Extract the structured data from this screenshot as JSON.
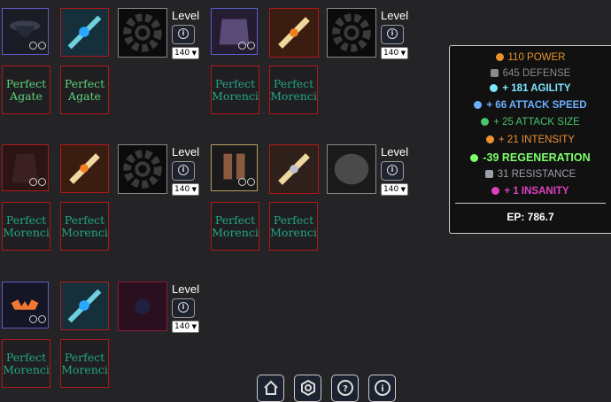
{
  "level_label": "Level",
  "level_value": "140",
  "gems": {
    "row1": [
      {
        "line1": "Perfect",
        "line2": "Agate",
        "color": "#5fd37a"
      },
      {
        "line1": "Perfect",
        "line2": "Agate",
        "color": "#5fd37a"
      },
      {
        "line1": "Perfect",
        "line2": "Morenci",
        "color": "#25a386"
      },
      {
        "line1": "Perfect",
        "line2": "Morenci",
        "color": "#25a386"
      }
    ],
    "row2": [
      {
        "line1": "Perfect",
        "line2": "Morenci",
        "color": "#25a386"
      },
      {
        "line1": "Perfect",
        "line2": "Morenci",
        "color": "#25a386"
      },
      {
        "line1": "Perfect",
        "line2": "Morenci",
        "color": "#25a386"
      },
      {
        "line1": "Perfect",
        "line2": "Morenci",
        "color": "#25a386"
      }
    ],
    "row3": [
      {
        "line1": "Perfect",
        "line2": "Morenci",
        "color": "#25a386"
      },
      {
        "line1": "Perfect",
        "line2": "Morenci",
        "color": "#25a386"
      }
    ]
  },
  "stats": [
    {
      "text": "110 POWER",
      "color": "#e8922a",
      "icon": "power-icon",
      "bold": false
    },
    {
      "text": "645 DEFENSE",
      "color": "#8a8a8a",
      "icon": "defense-icon",
      "bold": false
    },
    {
      "text": "+ 181 AGILITY",
      "color": "#7fe6ff",
      "icon": "agility-icon",
      "bold": true
    },
    {
      "text": "+ 66 ATTACK SPEED",
      "color": "#6ab0ff",
      "icon": "attack-speed-icon",
      "bold": true
    },
    {
      "text": "+ 25 ATTACK SIZE",
      "color": "#49c46a",
      "icon": "attack-size-icon",
      "bold": false
    },
    {
      "text": "+ 21 INTENSITY",
      "color": "#f09030",
      "icon": "intensity-icon",
      "bold": false
    },
    {
      "text": "-39 REGENERATION",
      "color": "#7dff6a",
      "icon": "regeneration-icon",
      "bold": true
    },
    {
      "text": "31 RESISTANCE",
      "color": "#9aa0a8",
      "icon": "resistance-icon",
      "bold": false
    },
    {
      "text": "+ 1 INSANITY",
      "color": "#e040c0",
      "icon": "insanity-icon",
      "bold": true
    }
  ],
  "ep_text": "EP: 786.7",
  "nav": [
    {
      "icon": "home-icon"
    },
    {
      "icon": "settings-icon"
    },
    {
      "icon": "help-icon"
    },
    {
      "icon": "info-icon"
    }
  ]
}
